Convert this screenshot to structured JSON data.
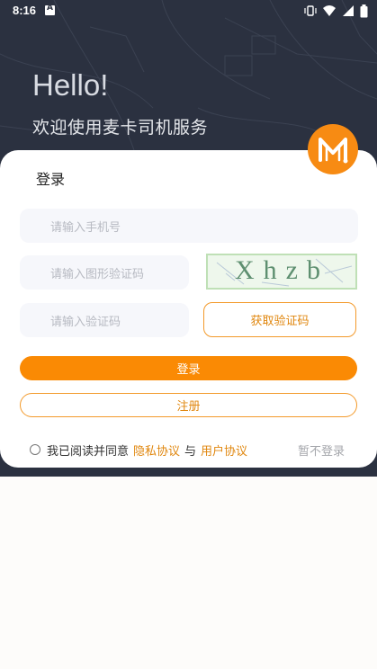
{
  "status_bar": {
    "time": "8:16"
  },
  "hero": {
    "hello": "Hello!",
    "welcome": "欢迎使用麦卡司机服务"
  },
  "login": {
    "title": "登录",
    "phone_placeholder": "请输入手机号",
    "captcha_placeholder": "请输入图形验证码",
    "captcha_text": "Xhzb",
    "code_placeholder": "请输入验证码",
    "get_code_label": "获取验证码",
    "login_label": "登录",
    "register_label": "注册"
  },
  "agreement": {
    "prefix": "我已阅读并同意",
    "privacy_link": "隐私协议",
    "conjunction": "与",
    "user_link": "用户协议",
    "skip_label": "暂不登录"
  },
  "colors": {
    "accent": "#fa8a04",
    "header_bg": "#2b3140",
    "input_bg": "#f6f7fb"
  },
  "icons": [
    "vibrate-icon",
    "wifi-icon",
    "signal-icon",
    "battery-icon",
    "app-logo-icon"
  ]
}
